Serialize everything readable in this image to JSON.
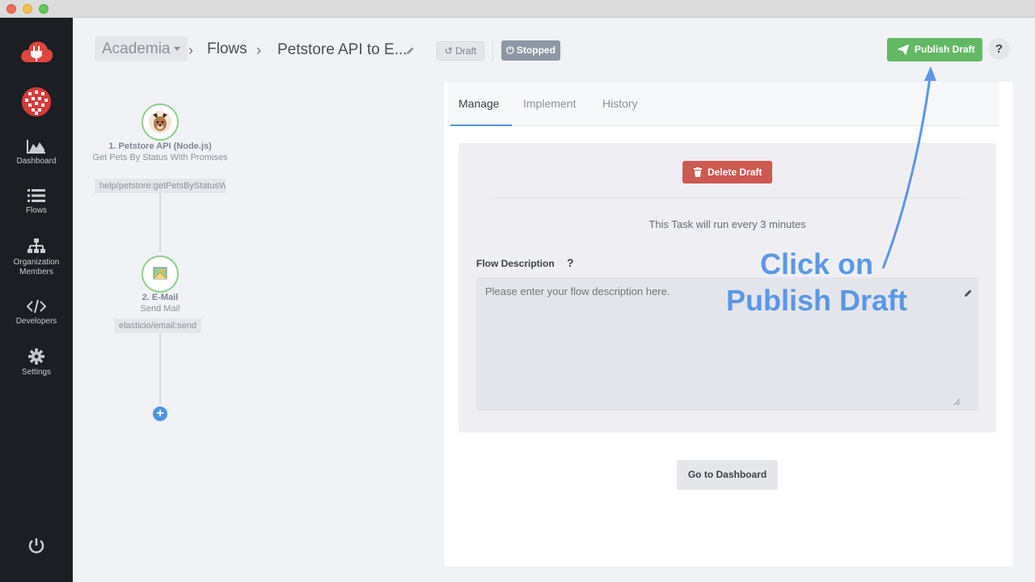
{
  "window": {
    "controls": [
      "close",
      "minimize",
      "zoom"
    ]
  },
  "sidebar": {
    "logo_icon": "cloud-plug-icon",
    "items": [
      {
        "label": "Dashboard",
        "icon": "area-chart-icon"
      },
      {
        "label": "Flows",
        "icon": "list-icon"
      },
      {
        "label": "Organization Members",
        "icon": "org-tree-icon"
      },
      {
        "label": "Developers",
        "icon": "code-icon"
      },
      {
        "label": "Settings",
        "icon": "gear-icon"
      }
    ],
    "power_icon": "power-icon"
  },
  "header": {
    "workspace": "Academia",
    "section": "Flows",
    "flow_name": "Petstore API to E...",
    "draft_badge": "Draft",
    "status_badge": "Stopped",
    "publish_button": "Publish Draft",
    "help": "?"
  },
  "flow_steps": [
    {
      "title": "1. Petstore API (Node.js)",
      "subtitle": "Get Pets By Status With Promises",
      "tag": "help/petstore:getPetsByStatusW",
      "icon": "dog-icon"
    },
    {
      "title": "2. E-Mail",
      "subtitle": "Send Mail",
      "tag": "elasticio/email:send",
      "icon": "mail-icon"
    }
  ],
  "add_step": "+",
  "panel": {
    "tabs": [
      "Manage",
      "Implement",
      "History"
    ],
    "active_tab": "Manage",
    "delete_button": "Delete Draft",
    "schedule_text": "This Task will run every 3 minutes",
    "description_label": "Flow Description",
    "description_help": "?",
    "description_placeholder": "Please enter your flow description here.",
    "dashboard_button": "Go to Dashboard"
  },
  "annotation": {
    "line1": "Click on",
    "line2": "Publish Draft"
  },
  "colors": {
    "publish": "#63b865",
    "delete": "#cc5a52",
    "accent": "#4c95e4",
    "annotation": "#5a97e6",
    "sidebar": "#1b1e22"
  }
}
